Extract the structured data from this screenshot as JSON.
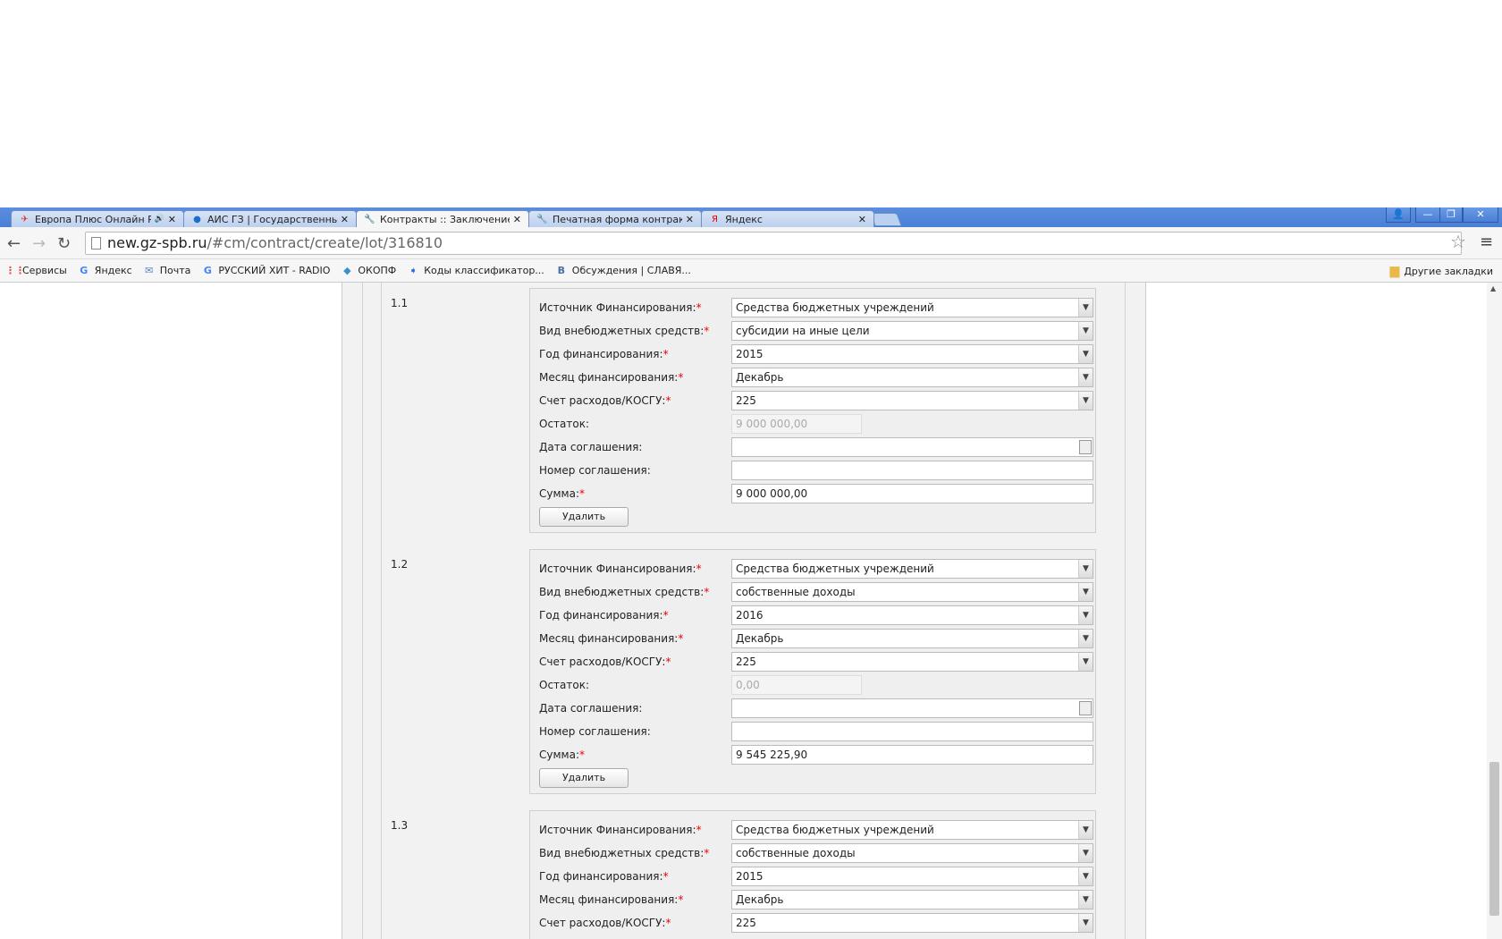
{
  "browser": {
    "tabs": [
      {
        "title": "Европа Плюс Онлайн Ра",
        "icon": "europa-plus-icon",
        "audio": true
      },
      {
        "title": "АИС ГЗ | Государственный",
        "icon": "ais-gz-icon"
      },
      {
        "title": "Контракты :: Заключение д",
        "icon": "tools-icon",
        "active": true
      },
      {
        "title": "Печатная форма контракта",
        "icon": "tools-icon"
      },
      {
        "title": "Яндекс",
        "icon": "yandex-icon"
      }
    ],
    "url_host": "new.gz-spb.ru",
    "url_path": "/#cm/contract/create/lot/316810",
    "bookmarks": [
      {
        "label": "Сервисы",
        "glyph": "⋮⋮",
        "color": "#e44"
      },
      {
        "label": "Яндекс",
        "glyph": "G",
        "color": "#4285f4"
      },
      {
        "label": "Почта",
        "glyph": "✉",
        "color": "#5b7fc7"
      },
      {
        "label": "РУССКИЙ ХИТ - RADIO",
        "glyph": "G",
        "color": "#4285f4"
      },
      {
        "label": "ОКОПФ",
        "glyph": "◆",
        "color": "#3a8fc9"
      },
      {
        "label": "Коды классификатор...",
        "glyph": "➧",
        "color": "#2a6fd6"
      },
      {
        "label": "Обсуждения | СЛАВЯ...",
        "glyph": "B",
        "color": "#4a6fa5"
      }
    ],
    "other_bookmarks": "Другие закладки"
  },
  "groups": [
    {
      "num": "1.1",
      "fields": [
        {
          "label": "Источник Финансирования:",
          "req": true,
          "type": "select",
          "value": "Средства бюджетных учреждений"
        },
        {
          "label": "Вид внебюджетных средств:",
          "req": true,
          "type": "select",
          "value": "субсидии на иные цели"
        },
        {
          "label": "Год финансирования:",
          "req": true,
          "type": "select",
          "value": "2015"
        },
        {
          "label": "Месяц финансирования:",
          "req": true,
          "type": "select",
          "value": "Декабрь"
        },
        {
          "label": "Счет расходов/КОСГУ:",
          "req": true,
          "type": "select",
          "value": "225"
        },
        {
          "label": "Остаток:",
          "type": "readonly",
          "value": "9 000 000,00"
        },
        {
          "label": "Дата соглашения:",
          "type": "date",
          "value": ""
        },
        {
          "label": "Номер соглашения:",
          "type": "text",
          "value": ""
        },
        {
          "label": "Сумма:",
          "req": true,
          "type": "text",
          "value": "9 000 000,00"
        }
      ],
      "delete_label": "Удалить"
    },
    {
      "num": "1.2",
      "fields": [
        {
          "label": "Источник Финансирования:",
          "req": true,
          "type": "select",
          "value": "Средства бюджетных учреждений"
        },
        {
          "label": "Вид внебюджетных средств:",
          "req": true,
          "type": "select",
          "value": "собственные доходы"
        },
        {
          "label": "Год финансирования:",
          "req": true,
          "type": "select",
          "value": "2016"
        },
        {
          "label": "Месяц финансирования:",
          "req": true,
          "type": "select",
          "value": "Декабрь"
        },
        {
          "label": "Счет расходов/КОСГУ:",
          "req": true,
          "type": "select",
          "value": "225"
        },
        {
          "label": "Остаток:",
          "type": "readonly",
          "value": "0,00"
        },
        {
          "label": "Дата соглашения:",
          "type": "date",
          "value": ""
        },
        {
          "label": "Номер соглашения:",
          "type": "text",
          "value": ""
        },
        {
          "label": "Сумма:",
          "req": true,
          "type": "text",
          "value": "9 545 225,90"
        }
      ],
      "delete_label": "Удалить"
    },
    {
      "num": "1.3",
      "fields": [
        {
          "label": "Источник Финансирования:",
          "req": true,
          "type": "select",
          "value": "Средства бюджетных учреждений"
        },
        {
          "label": "Вид внебюджетных средств:",
          "req": true,
          "type": "select",
          "value": "собственные доходы"
        },
        {
          "label": "Год финансирования:",
          "req": true,
          "type": "select",
          "value": "2015"
        },
        {
          "label": "Месяц финансирования:",
          "req": true,
          "type": "select",
          "value": "Декабрь"
        },
        {
          "label": "Счет расходов/КОСГУ:",
          "req": true,
          "type": "select",
          "value": "225"
        }
      ]
    }
  ]
}
